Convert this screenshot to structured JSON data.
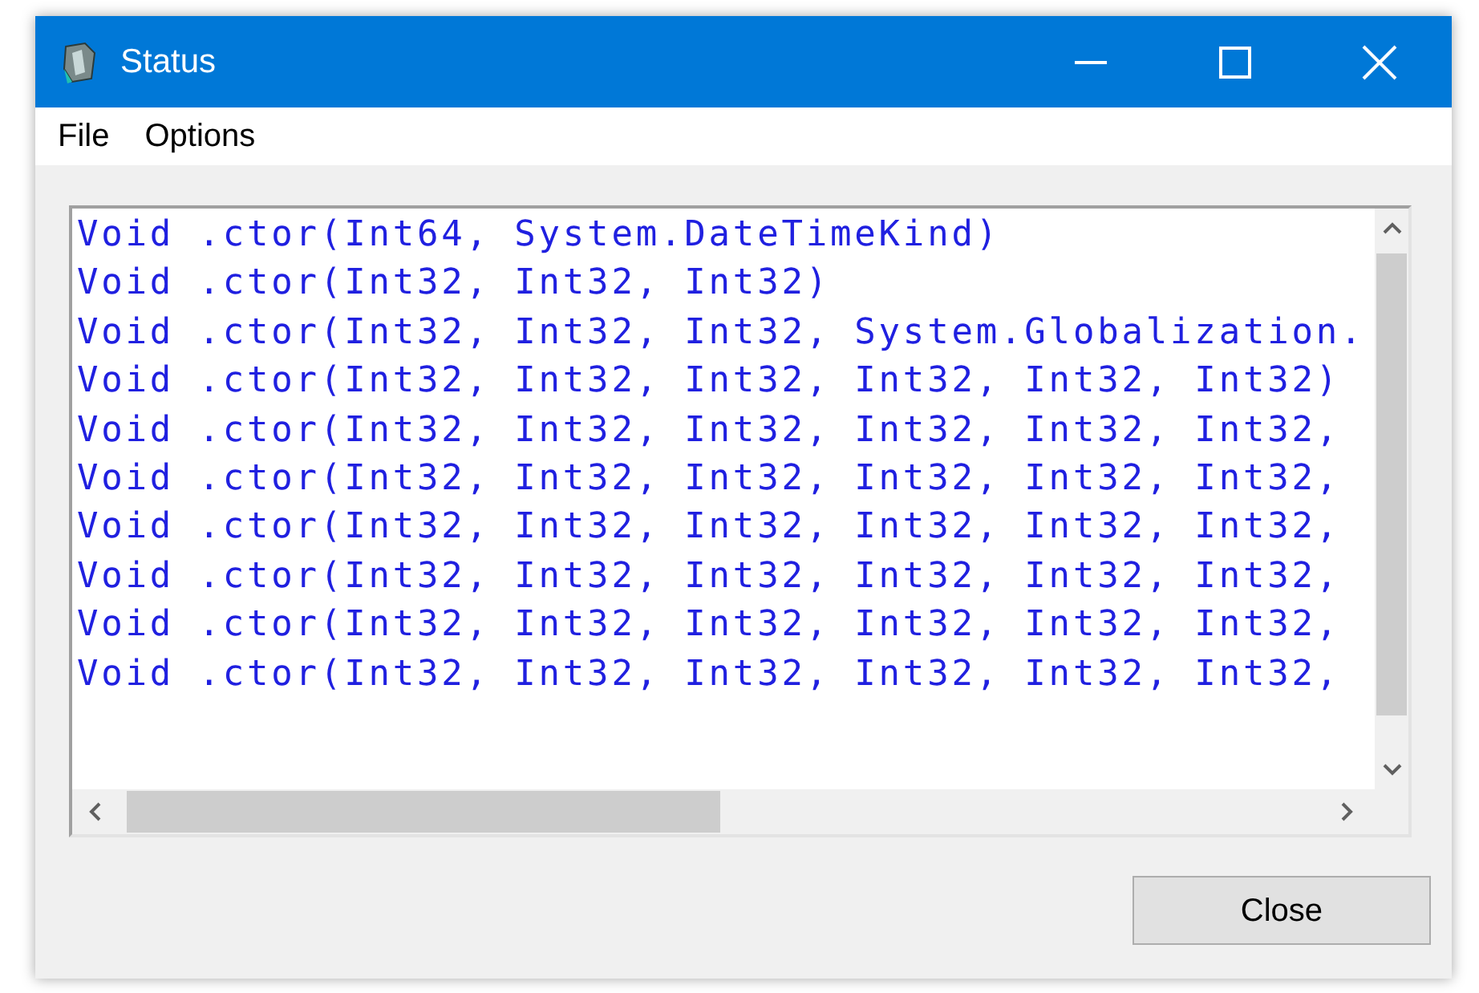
{
  "window": {
    "title": "Status"
  },
  "menu": [
    "File",
    "Options"
  ],
  "lines": [
    "Void .ctor(Int64, System.DateTimeKind)",
    "Void .ctor(Int32, Int32, Int32)",
    "Void .ctor(Int32, Int32, Int32, System.Globalization.",
    "Void .ctor(Int32, Int32, Int32, Int32, Int32, Int32)",
    "Void .ctor(Int32, Int32, Int32, Int32, Int32, Int32,",
    "Void .ctor(Int32, Int32, Int32, Int32, Int32, Int32,",
    "Void .ctor(Int32, Int32, Int32, Int32, Int32, Int32,",
    "Void .ctor(Int32, Int32, Int32, Int32, Int32, Int32,",
    "Void .ctor(Int32, Int32, Int32, Int32, Int32, Int32,",
    "Void .ctor(Int32, Int32, Int32, Int32, Int32, Int32,"
  ],
  "buttons": [
    "Close"
  ]
}
